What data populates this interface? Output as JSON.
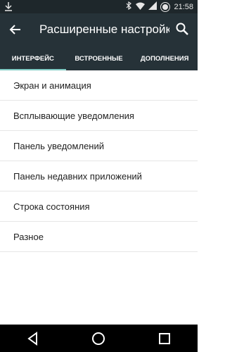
{
  "status_bar": {
    "download_icon": "download-arrow-icon",
    "time": "21:58"
  },
  "toolbar": {
    "title": "Расширенные настройки"
  },
  "tabs": [
    {
      "label": "ИНТЕРФЕЙС"
    },
    {
      "label": "ВСТРОЕННЫЕ"
    },
    {
      "label": "ДОПОЛНЕНИЯ"
    }
  ],
  "items": [
    {
      "label": "Экран и анимация"
    },
    {
      "label": "Всплывающие уведомления"
    },
    {
      "label": "Панель уведомлений"
    },
    {
      "label": "Панель недавних приложений"
    },
    {
      "label": "Строка состояния"
    },
    {
      "label": "Разное"
    }
  ],
  "colors": {
    "toolbar_bg": "#263238",
    "accent": "#80cbc4"
  }
}
